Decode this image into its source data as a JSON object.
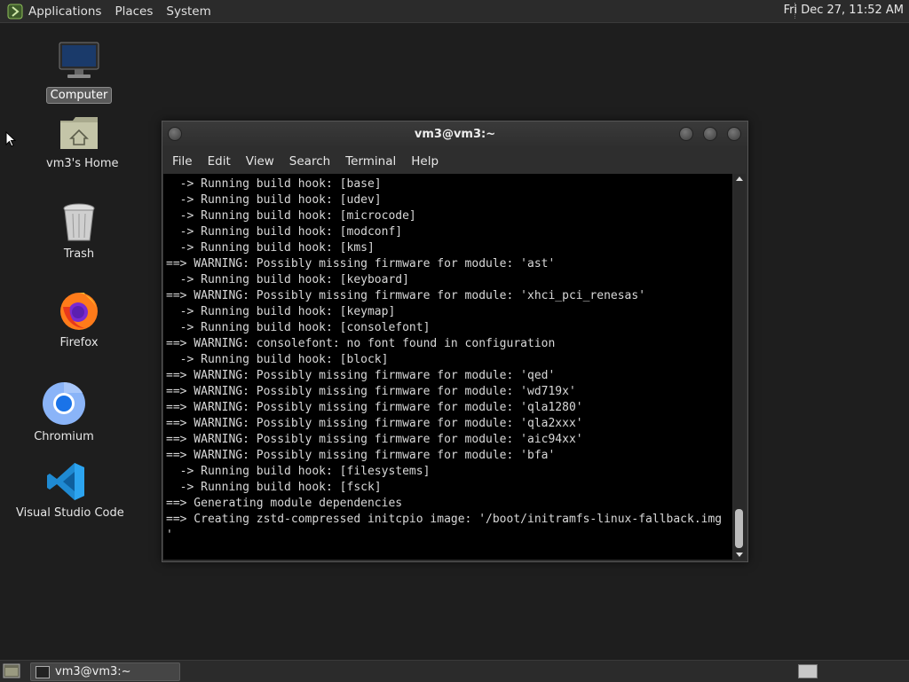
{
  "top_panel": {
    "menus": [
      "Applications",
      "Places",
      "System"
    ],
    "clock": "Fri Dec 27, 11:52 AM"
  },
  "desktop": {
    "icons": [
      {
        "label": "Computer",
        "icon": "computer-icon",
        "selected": true
      },
      {
        "label": "vm3's Home",
        "icon": "home-folder-icon"
      },
      {
        "label": "Trash",
        "icon": "trash-icon"
      },
      {
        "label": "Firefox",
        "icon": "firefox-icon"
      },
      {
        "label": "Chromium",
        "icon": "chromium-icon"
      },
      {
        "label": "Visual Studio Code",
        "icon": "vscode-icon"
      }
    ]
  },
  "terminal": {
    "title": "vm3@vm3:~",
    "menu": [
      "File",
      "Edit",
      "View",
      "Search",
      "Terminal",
      "Help"
    ],
    "lines": [
      "  -> Running build hook: [base]",
      "  -> Running build hook: [udev]",
      "  -> Running build hook: [microcode]",
      "  -> Running build hook: [modconf]",
      "  -> Running build hook: [kms]",
      "==> WARNING: Possibly missing firmware for module: 'ast'",
      "  -> Running build hook: [keyboard]",
      "==> WARNING: Possibly missing firmware for module: 'xhci_pci_renesas'",
      "  -> Running build hook: [keymap]",
      "  -> Running build hook: [consolefont]",
      "==> WARNING: consolefont: no font found in configuration",
      "  -> Running build hook: [block]",
      "==> WARNING: Possibly missing firmware for module: 'qed'",
      "==> WARNING: Possibly missing firmware for module: 'wd719x'",
      "==> WARNING: Possibly missing firmware for module: 'qla1280'",
      "==> WARNING: Possibly missing firmware for module: 'qla2xxx'",
      "==> WARNING: Possibly missing firmware for module: 'aic94xx'",
      "==> WARNING: Possibly missing firmware for module: 'bfa'",
      "  -> Running build hook: [filesystems]",
      "  -> Running build hook: [fsck]",
      "==> Generating module dependencies",
      "==> Creating zstd-compressed initcpio image: '/boot/initramfs-linux-fallback.img",
      "'"
    ]
  },
  "taskbar": {
    "items": [
      {
        "label": "vm3@vm3:~",
        "icon": "terminal-icon"
      }
    ]
  }
}
